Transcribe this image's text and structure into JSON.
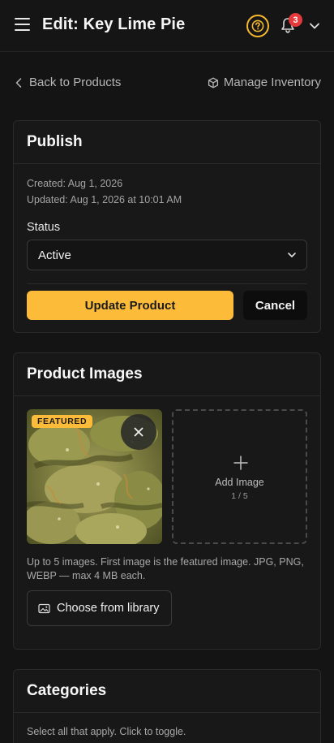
{
  "header": {
    "title": "Edit: Key Lime Pie",
    "notification_count": "3",
    "accent_color": "#fdbb3a",
    "badge_color": "#e5393b"
  },
  "subnav": {
    "back_label": "Back to Products",
    "manage_label": "Manage Inventory"
  },
  "publish": {
    "title": "Publish",
    "created": "Created: Aug 1, 2026",
    "updated": "Updated: Aug 1, 2026 at 10:01 AM",
    "status_label": "Status",
    "status_value": "Active",
    "update_button": "Update Product",
    "cancel_button": "Cancel"
  },
  "images": {
    "title": "Product Images",
    "featured_tag": "FEATURED",
    "add_label": "Add Image",
    "count": "1 / 5",
    "hint": "Up to 5 images. First image is the featured image. JPG, PNG, WEBP — max 4 MB each.",
    "library_button": "Choose from library"
  },
  "categories": {
    "title": "Categories",
    "hint": "Select all that apply. Click to toggle."
  }
}
